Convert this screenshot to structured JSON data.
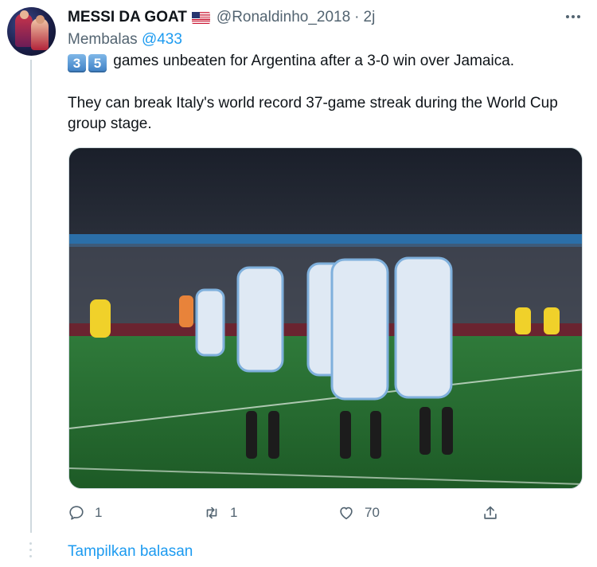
{
  "tweet": {
    "display_name": "MESSI DA GOAT",
    "flag_icon": "us-flag-icon",
    "handle": "@Ronaldinho_2018",
    "separator": "·",
    "time": "2j",
    "more_icon": "more-horizontal-icon",
    "reply_prefix": "Membalas",
    "reply_handle": "@433",
    "keycap_1": "3",
    "keycap_2": "5",
    "line1_text": " games unbeaten for Argentina after a 3-0 win over Jamaica.",
    "line2_text": "They can break Italy's world record 37-game streak during the World Cup group stage."
  },
  "actions": {
    "reply_icon": "reply-icon",
    "reply_count": "1",
    "retweet_icon": "retweet-icon",
    "retweet_count": "1",
    "like_icon": "heart-icon",
    "like_count": "70",
    "share_icon": "share-icon"
  },
  "show_replies": "Tampilkan balasan",
  "colors": {
    "accent": "#1d9bf0",
    "secondary_text": "#536471",
    "thread_line": "#cfd9de"
  }
}
